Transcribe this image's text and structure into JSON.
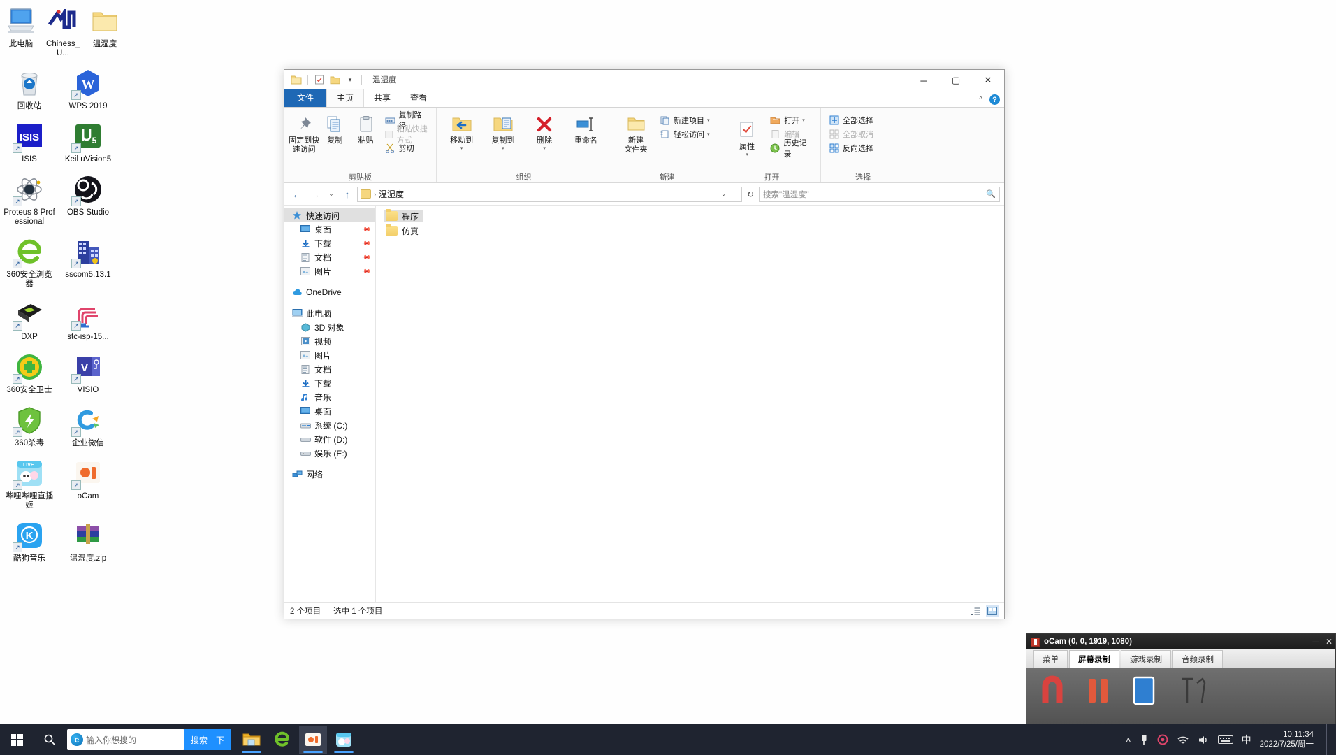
{
  "desktop": {
    "icons": [
      {
        "label": "此电脑",
        "icon": "this-pc-icon"
      },
      {
        "label": "Chiness_U...",
        "icon": "chiness-u-icon"
      },
      {
        "label": "温湿度",
        "icon": "folder-icon"
      },
      {
        "label": "回收站",
        "icon": "recycle-bin-icon"
      },
      {
        "label": "WPS 2019",
        "icon": "wps-icon"
      },
      {
        "label": "ISIS",
        "icon": "isis-icon"
      },
      {
        "label": "Keil uVision5",
        "icon": "keil-icon"
      },
      {
        "label": "Proteus 8 Professional",
        "icon": "proteus-icon"
      },
      {
        "label": "OBS Studio",
        "icon": "obs-icon"
      },
      {
        "label": "360安全浏览器",
        "icon": "ie-browser-icon"
      },
      {
        "label": "sscom5.13.1",
        "icon": "sscom-icon"
      },
      {
        "label": "DXP",
        "icon": "dxp-icon"
      },
      {
        "label": "stc-isp-15...",
        "icon": "stc-isp-icon"
      },
      {
        "label": "360安全卫士",
        "icon": "360-guard-icon"
      },
      {
        "label": "VISIO",
        "icon": "visio-icon"
      },
      {
        "label": "360杀毒",
        "icon": "360-antivirus-icon"
      },
      {
        "label": "企业微信",
        "icon": "wechat-work-icon"
      },
      {
        "label": "哔哩哔哩直播姬",
        "icon": "bilibili-live-icon"
      },
      {
        "label": "oCam",
        "icon": "ocam-icon"
      },
      {
        "label": "酷狗音乐",
        "icon": "kugou-icon"
      },
      {
        "label": "温湿度.zip",
        "icon": "winrar-zip-icon"
      }
    ]
  },
  "explorer": {
    "title": "温湿度",
    "quick_access_toolbar": [
      {
        "name": "properties-icon",
        "glyph": "▤"
      },
      {
        "name": "new-folder-icon",
        "glyph": "▣"
      },
      {
        "name": "customize-dropdown-icon",
        "glyph": "▾"
      }
    ],
    "window_controls": {
      "minimize": "─",
      "maximize": "▢",
      "close": "✕"
    },
    "tabs": [
      {
        "label": "文件",
        "active": false,
        "is_file_tab": true
      },
      {
        "label": "主页",
        "active": true,
        "is_file_tab": false
      },
      {
        "label": "共享",
        "active": false,
        "is_file_tab": false
      },
      {
        "label": "查看",
        "active": false,
        "is_file_tab": false
      }
    ],
    "ribbon": {
      "collapse_label": "^",
      "help_label": "?",
      "groups": [
        {
          "label": "剪贴板",
          "big_buttons": [
            {
              "label": "固定到快\n速访问",
              "icon": "pin-icon",
              "disabled": false
            },
            {
              "label": "复制",
              "icon": "copy-icon",
              "disabled": false
            },
            {
              "label": "粘贴",
              "icon": "paste-icon",
              "disabled": false
            }
          ],
          "small_buttons": [
            {
              "label": "复制路径",
              "icon": "copy-path-icon",
              "disabled": false
            },
            {
              "label": "粘贴快捷方式",
              "icon": "paste-shortcut-icon",
              "disabled": true
            },
            {
              "label": "剪切",
              "icon": "cut-icon",
              "disabled": false
            }
          ]
        },
        {
          "label": "组织",
          "big_buttons": [
            {
              "label": "移动到",
              "icon": "move-to-icon",
              "has_caret": true
            },
            {
              "label": "复制到",
              "icon": "copy-to-icon",
              "has_caret": true
            },
            {
              "label": "删除",
              "icon": "delete-icon",
              "has_caret": true
            },
            {
              "label": "重命名",
              "icon": "rename-icon",
              "has_caret": false
            }
          ],
          "small_buttons": []
        },
        {
          "label": "新建",
          "big_buttons": [
            {
              "label": "新建\n文件夹",
              "icon": "new-folder-icon",
              "disabled": false
            }
          ],
          "small_buttons": [
            {
              "label": "新建项目",
              "icon": "new-item-icon",
              "has_caret": true
            },
            {
              "label": "轻松访问",
              "icon": "easy-access-icon",
              "has_caret": true
            }
          ]
        },
        {
          "label": "打开",
          "big_buttons": [
            {
              "label": "属性",
              "icon": "properties-icon",
              "has_caret": true
            }
          ],
          "small_buttons": [
            {
              "label": "打开",
              "icon": "open-icon",
              "has_caret": true
            },
            {
              "label": "编辑",
              "icon": "edit-icon",
              "disabled": true
            },
            {
              "label": "历史记录",
              "icon": "history-icon",
              "disabled": false
            }
          ]
        },
        {
          "label": "选择",
          "big_buttons": [],
          "small_buttons": [
            {
              "label": "全部选择",
              "icon": "select-all-icon",
              "disabled": false
            },
            {
              "label": "全部取消",
              "icon": "select-none-icon",
              "disabled": true
            },
            {
              "label": "反向选择",
              "icon": "invert-selection-icon",
              "disabled": false
            }
          ]
        }
      ]
    },
    "address_bar": {
      "back_label": "←",
      "forward_label": "→",
      "recent_label": "⌄",
      "up_label": "↑",
      "path_text": "温湿度",
      "path_separator": "›",
      "dropdown_label": "⌄",
      "refresh_label": "↻"
    },
    "search": {
      "placeholder": "搜索\"温湿度\"",
      "icon": "search-icon"
    },
    "nav_pane": [
      {
        "label": "快速访问",
        "icon": "quick-access-star-icon",
        "selected": true,
        "indent": false,
        "pinned": false
      },
      {
        "label": "桌面",
        "icon": "desktop-icon",
        "selected": false,
        "indent": true,
        "pinned": true
      },
      {
        "label": "下载",
        "icon": "downloads-icon",
        "selected": false,
        "indent": true,
        "pinned": true
      },
      {
        "label": "文档",
        "icon": "documents-icon",
        "selected": false,
        "indent": true,
        "pinned": true
      },
      {
        "label": "图片",
        "icon": "pictures-icon",
        "selected": false,
        "indent": true,
        "pinned": true
      },
      {
        "label": "OneDrive",
        "icon": "onedrive-cloud-icon",
        "selected": false,
        "indent": false,
        "pinned": false,
        "gap_before": true
      },
      {
        "label": "此电脑",
        "icon": "this-pc-icon",
        "selected": false,
        "indent": false,
        "pinned": false,
        "gap_before": true
      },
      {
        "label": "3D 对象",
        "icon": "3d-objects-icon",
        "selected": false,
        "indent": true,
        "pinned": false
      },
      {
        "label": "视频",
        "icon": "videos-icon",
        "selected": false,
        "indent": true,
        "pinned": false
      },
      {
        "label": "图片",
        "icon": "pictures-icon",
        "selected": false,
        "indent": true,
        "pinned": false
      },
      {
        "label": "文档",
        "icon": "documents-icon",
        "selected": false,
        "indent": true,
        "pinned": false
      },
      {
        "label": "下载",
        "icon": "downloads-icon",
        "selected": false,
        "indent": true,
        "pinned": false
      },
      {
        "label": "音乐",
        "icon": "music-icon",
        "selected": false,
        "indent": true,
        "pinned": false
      },
      {
        "label": "桌面",
        "icon": "desktop-icon",
        "selected": false,
        "indent": true,
        "pinned": false
      },
      {
        "label": "系统 (C:)",
        "icon": "system-drive-icon",
        "selected": false,
        "indent": true,
        "pinned": false
      },
      {
        "label": "软件 (D:)",
        "icon": "drive-icon",
        "selected": false,
        "indent": true,
        "pinned": false
      },
      {
        "label": "娱乐 (E:)",
        "icon": "drive-icon",
        "selected": false,
        "indent": true,
        "pinned": false
      },
      {
        "label": "网络",
        "icon": "network-icon",
        "selected": false,
        "indent": false,
        "pinned": false,
        "gap_before": true
      }
    ],
    "files": [
      {
        "name": "程序",
        "type": "folder",
        "selected": true
      },
      {
        "name": "仿真",
        "type": "folder",
        "selected": false
      }
    ],
    "status": {
      "item_count": "2 个项目",
      "selection": "选中 1 个项目",
      "view_details_icon": "details-view-icon",
      "view_large_icon": "large-icons-view-icon"
    }
  },
  "ocam": {
    "title": "oCam (0, 0, 1919, 1080)",
    "window_controls": {
      "minimize": "─",
      "close": "✕"
    },
    "tabs": [
      {
        "label": "菜单",
        "active": false
      },
      {
        "label": "屏幕录制",
        "active": true
      },
      {
        "label": "游戏录制",
        "active": false
      },
      {
        "label": "音频录制",
        "active": false
      }
    ],
    "toolbar_buttons": [
      {
        "name": "record-button",
        "color": "#d9433f"
      },
      {
        "name": "pause-button",
        "color": "#e2593c"
      },
      {
        "name": "capture-button",
        "color": "#2f7fd1"
      },
      {
        "name": "resize-button",
        "color": "#555555"
      }
    ]
  },
  "taskbar": {
    "start_label": "Start",
    "search_icon": "search-icon",
    "search": {
      "placeholder": "输入你想搜的",
      "button_label": "搜索一下",
      "browser_icon": "edge-icon"
    },
    "apps": [
      {
        "name": "file-explorer",
        "icon": "folder-taskbar-icon",
        "open": true,
        "active": false
      },
      {
        "name": "360-browser",
        "icon": "360-browser-icon",
        "open": false,
        "active": false
      },
      {
        "name": "ocam",
        "icon": "ocam-taskbar-icon",
        "open": true,
        "active": true
      },
      {
        "name": "bilibili-live",
        "icon": "bilibili-taskbar-icon",
        "open": true,
        "active": false
      }
    ],
    "tray": {
      "icons": [
        {
          "name": "show-hidden-icons-chevron",
          "glyph": "˄"
        },
        {
          "name": "usb-eject-icon",
          "glyph": "🗲"
        },
        {
          "name": "360-tray-icon",
          "glyph": "◎"
        },
        {
          "name": "wifi-icon",
          "glyph": "◔"
        },
        {
          "name": "volume-icon",
          "glyph": "◁"
        },
        {
          "name": "keyboard-icon",
          "glyph": "⌨"
        },
        {
          "name": "ime-icon",
          "glyph": "中"
        }
      ],
      "time": "10:11:34",
      "date": "2022/7/25/周一"
    }
  }
}
